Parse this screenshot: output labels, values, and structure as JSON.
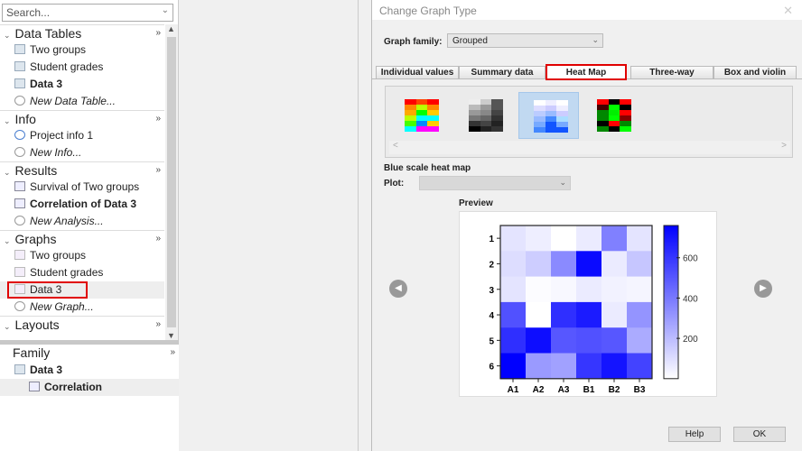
{
  "sidebar": {
    "search_placeholder": "Search...",
    "sections": [
      {
        "title": "Data Tables",
        "items": [
          "Two groups",
          "Student grades",
          "Data 3"
        ],
        "new": "New Data Table..."
      },
      {
        "title": "Info",
        "items": [
          "Project info 1"
        ],
        "new": "New Info..."
      },
      {
        "title": "Results",
        "items": [
          "Survival of Two groups",
          "Correlation of Data 3"
        ],
        "new": "New Analysis..."
      },
      {
        "title": "Graphs",
        "items": [
          "Two groups",
          "Student grades",
          "Data 3"
        ],
        "new": "New Graph..."
      },
      {
        "title": "Layouts"
      }
    ],
    "family": {
      "title": "Family",
      "items": [
        "Data 3",
        "Correlation"
      ]
    }
  },
  "dialog": {
    "title": "Change Graph Type",
    "graph_family_label": "Graph family:",
    "graph_family_value": "Grouped",
    "tabs": [
      "Individual values",
      "Summary data",
      "Heat Map",
      "Three-way",
      "Box and violin"
    ],
    "active_tab": "Heat Map",
    "selected_type": "Blue scale heat map",
    "plot_label": "Plot:",
    "preview_label": "Preview",
    "help": "Help",
    "ok": "OK",
    "highlight_color": "#e00000"
  },
  "chart_data": {
    "type": "heatmap",
    "columns": [
      "A1",
      "A2",
      "A3",
      "B1",
      "B2",
      "B3"
    ],
    "rows": [
      "1",
      "2",
      "3",
      "4",
      "5",
      "6"
    ],
    "values": [
      [
        80,
        50,
        0,
        60,
        380,
        80
      ],
      [
        100,
        150,
        350,
        730,
        60,
        170
      ],
      [
        80,
        10,
        20,
        60,
        40,
        30
      ],
      [
        520,
        0,
        620,
        680,
        60,
        320
      ],
      [
        620,
        720,
        500,
        520,
        500,
        250
      ],
      [
        760,
        300,
        280,
        600,
        700,
        560
      ]
    ],
    "colorbar": {
      "ticks": [
        "200",
        "400",
        "600"
      ],
      "range": [
        0,
        760
      ],
      "low_color": "#ffffff",
      "high_color": "#0000ff"
    }
  }
}
